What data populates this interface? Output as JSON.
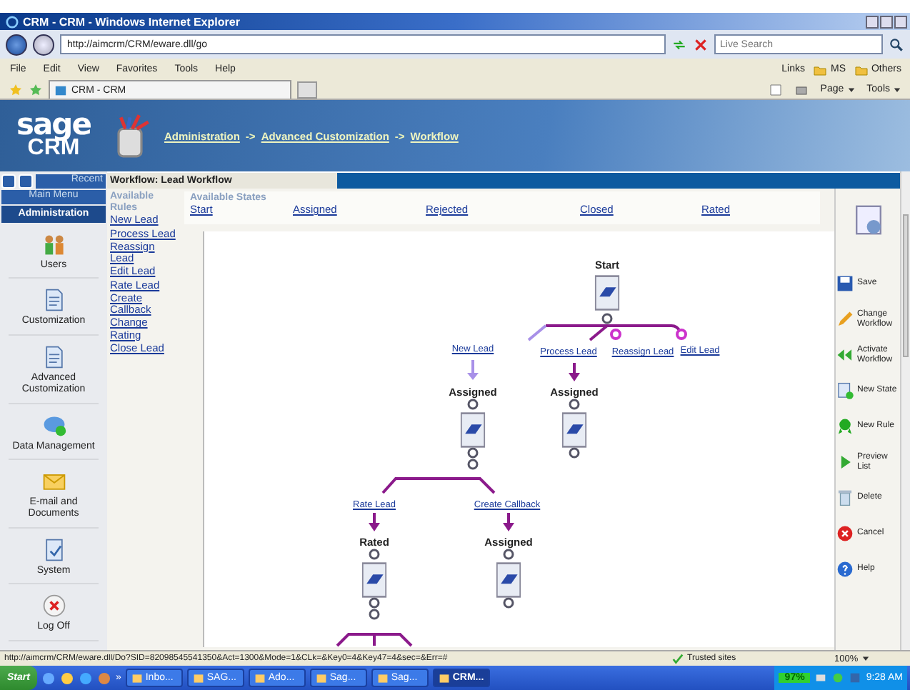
{
  "window": {
    "title": "CRM - CRM - Windows Internet Explorer"
  },
  "address_bar": {
    "url": "http://aimcrm/CRM/eware.dll/go"
  },
  "search": {
    "placeholder": "Live Search"
  },
  "menu": [
    "File",
    "Edit",
    "View",
    "Favorites",
    "Tools",
    "Help"
  ],
  "links": {
    "label": "Links",
    "items": [
      "MS",
      "Others"
    ]
  },
  "tab": {
    "title": "CRM - CRM"
  },
  "command_bar": [
    "Page",
    "Tools"
  ],
  "logo": {
    "line1": "sage",
    "line2": "CRM"
  },
  "breadcrumb": {
    "items": [
      "Administration",
      "Advanced Customization",
      "Workflow"
    ],
    "separator": "->"
  },
  "nav": {
    "recent": "Recent",
    "main_menu": "Main Menu",
    "section": "Administration",
    "items": [
      {
        "label": "Users"
      },
      {
        "label": "Customization"
      },
      {
        "label": "Advanced Customization"
      },
      {
        "label": "Data Management"
      },
      {
        "label": "E-mail and Documents"
      },
      {
        "label": "System"
      },
      {
        "label": "Log Off"
      }
    ]
  },
  "workflow": {
    "title": "Workflow: Lead Workflow",
    "rules_heading": "Available Rules",
    "rules": [
      "New Lead",
      "Process Lead",
      "Reassign Lead",
      "Edit Lead",
      "Rate Lead",
      "Create Callback",
      "Change Rating",
      "Close Lead"
    ],
    "states_heading": "Available States",
    "states": [
      "Start",
      "Assigned",
      "Rejected",
      "Closed",
      "Rated"
    ]
  },
  "diagram": {
    "states": [
      "Start",
      "Assigned",
      "Assigned",
      "Rated",
      "Assigned"
    ],
    "rules": [
      "New Lead",
      "Process Lead",
      "Reassign Lead",
      "Edit Lead",
      "Rate Lead",
      "Create Callback"
    ]
  },
  "actions": [
    "Save",
    "Change Workflow",
    "Activate Workflow",
    "New State",
    "New Rule",
    "Preview List",
    "Delete",
    "Cancel",
    "Help"
  ],
  "status_bar": {
    "url": "http://aimcrm/CRM/eware.dll/Do?SID=82098545541350&Act=1300&Mode=1&CLk=&Key0=4&Key47=4&sec=&Err=#",
    "zone": "Trusted sites",
    "zoom": "100%"
  },
  "taskbar": {
    "start": "Start",
    "more": "»",
    "buttons": [
      {
        "label": "Inbo...",
        "selected": false
      },
      {
        "label": "SAG...",
        "selected": false
      },
      {
        "label": "Ado...",
        "selected": false
      },
      {
        "label": "Sag...",
        "selected": false
      },
      {
        "label": "Sag...",
        "selected": false
      },
      {
        "label": "CRM...",
        "selected": true
      }
    ],
    "battery": "97%",
    "time": "9:28 AM"
  }
}
